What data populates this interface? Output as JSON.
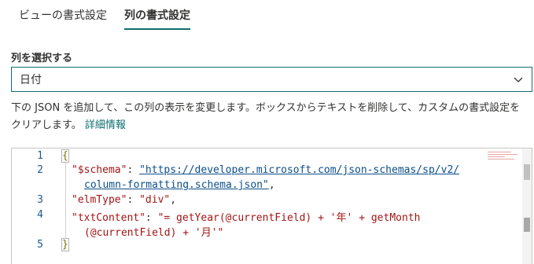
{
  "tabs": [
    {
      "label": "ビューの書式設定",
      "active": false
    },
    {
      "label": "列の書式設定",
      "active": true
    }
  ],
  "column_select": {
    "label": "列を選択する",
    "value": "日付"
  },
  "description": {
    "text": "下の JSON を追加して、この列の表示を変更します。ボックスからテキストを削除して、カスタムの書式設定をクリアします。",
    "link": "詳細情報"
  },
  "editor": {
    "line_numbers": [
      "1",
      "2",
      "3",
      "4",
      "5"
    ],
    "lines": {
      "l1": "{",
      "l2_key": "\"$schema\"",
      "l2_colon": ": ",
      "l2_url_a": "\"https://developer.microsoft.com/json-schemas/sp/v2/",
      "l2_url_b": "column-formatting.schema.json\"",
      "l2_comma": ",",
      "l3_key": "\"elmType\"",
      "l3_colon": ": ",
      "l3_val": "\"div\"",
      "l3_comma": ",",
      "l4_key": "\"txtContent\"",
      "l4_colon": ": ",
      "l4_val_a": "\"= getYear(@currentField) + '年' + getMonth",
      "l4_val_b": "(@currentField) + '月'\"",
      "l5": "}"
    }
  },
  "colors": {
    "accent": "#0f6e6e",
    "key_string": "#a31515",
    "line_number": "#1e5a8c"
  }
}
